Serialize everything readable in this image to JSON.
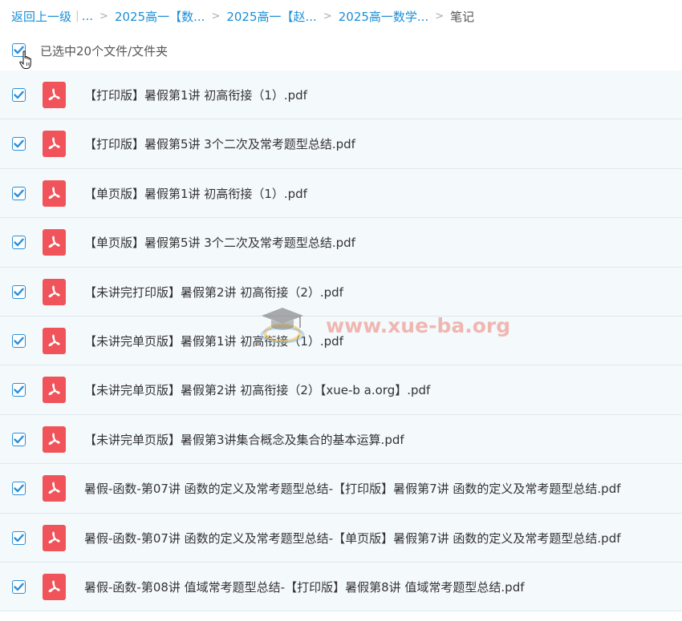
{
  "breadcrumb": {
    "back": "返回上一级",
    "more": "...",
    "sep": ">",
    "items": [
      "2025高一【数...",
      "2025高一【赵...",
      "2025高一数学..."
    ],
    "current": "笔记"
  },
  "selection": {
    "text": "已选中20个文件/文件夹",
    "checked": true
  },
  "files": [
    {
      "name": "【打印版】暑假第1讲 初高衔接（1）.pdf",
      "checked": true,
      "icon": "pdf-icon"
    },
    {
      "name": "【打印版】暑假第5讲 3个二次及常考题型总结.pdf",
      "checked": true,
      "icon": "pdf-icon"
    },
    {
      "name": "【单页版】暑假第1讲 初高衔接（1）.pdf",
      "checked": true,
      "icon": "pdf-icon"
    },
    {
      "name": "【单页版】暑假第5讲 3个二次及常考题型总结.pdf",
      "checked": true,
      "icon": "pdf-icon"
    },
    {
      "name": "【未讲完打印版】暑假第2讲 初高衔接（2）.pdf",
      "checked": true,
      "icon": "pdf-icon"
    },
    {
      "name": "【未讲完单页版】暑假第1讲 初高衔接（1）.pdf",
      "checked": true,
      "icon": "pdf-icon"
    },
    {
      "name": "【未讲完单页版】暑假第2讲 初高衔接（2）【xue-b a.org】.pdf",
      "checked": true,
      "icon": "pdf-icon"
    },
    {
      "name": "【未讲完单页版】暑假第3讲集合概念及集合的基本运算.pdf",
      "checked": true,
      "icon": "pdf-icon"
    },
    {
      "name": "暑假-函数-第07讲 函数的定义及常考题型总结-【打印版】暑假第7讲 函数的定义及常考题型总结.pdf",
      "checked": true,
      "icon": "pdf-icon"
    },
    {
      "name": "暑假-函数-第07讲 函数的定义及常考题型总结-【单页版】暑假第7讲 函数的定义及常考题型总结.pdf",
      "checked": true,
      "icon": "pdf-icon"
    },
    {
      "name": "暑假-函数-第08讲 值域常考题型总结-【打印版】暑假第8讲 值域常考题型总结.pdf",
      "checked": true,
      "icon": "pdf-icon"
    }
  ],
  "watermark": {
    "text": "www.xue-ba.org"
  },
  "colors": {
    "link": "#1a8fd6",
    "checkbox": "#2b8fd8",
    "pdf": "#f0545a",
    "row_bg": "#f4f9fc"
  }
}
